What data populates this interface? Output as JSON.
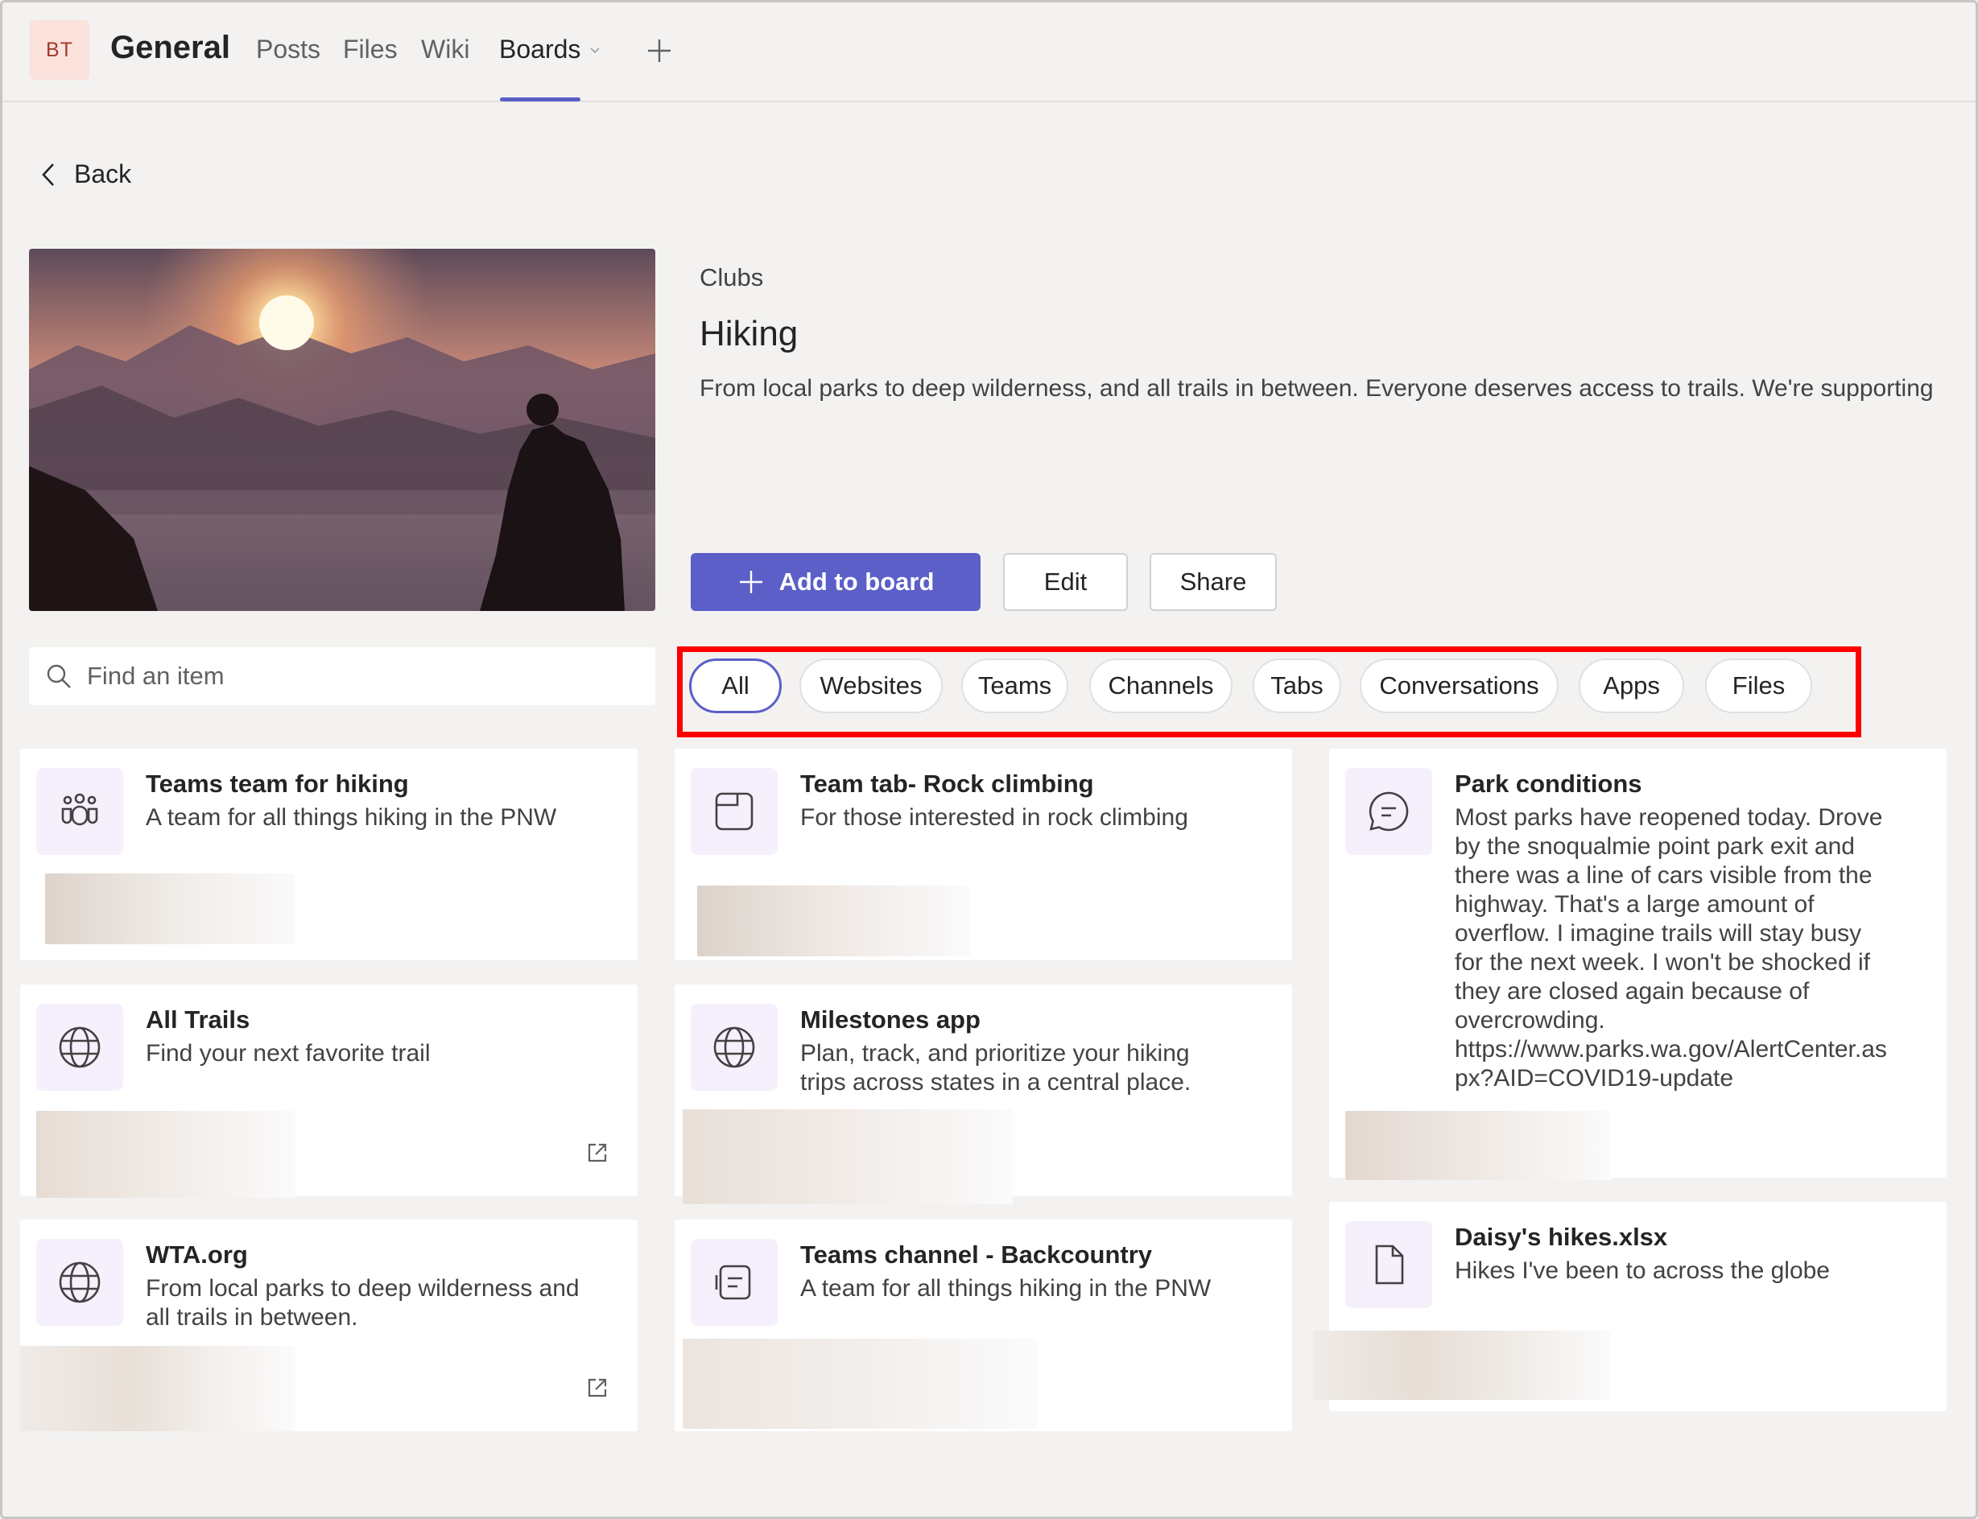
{
  "header": {
    "avatar_initials": "BT",
    "team_name": "General",
    "tabs": [
      {
        "label": "Posts"
      },
      {
        "label": "Files"
      },
      {
        "label": "Wiki"
      },
      {
        "label": "Boards",
        "active": true
      }
    ],
    "accent_color": "#5b5fc7"
  },
  "nav": {
    "back_label": "Back"
  },
  "board": {
    "category": "Clubs",
    "title": "Hiking",
    "description": "From local parks to deep wilderness, and all trails in between. Everyone deserves access to trails. We're supporting",
    "buttons": {
      "add": "Add to board",
      "edit": "Edit",
      "share": "Share"
    }
  },
  "search": {
    "placeholder": "Find an item"
  },
  "filters": [
    "All",
    "Websites",
    "Teams",
    "Channels",
    "Tabs",
    "Conversations",
    "Apps",
    "Files"
  ],
  "cards": [
    {
      "icon": "teams-icon",
      "title": "Teams team for hiking",
      "desc": "A team for all things hiking in the PNW"
    },
    {
      "icon": "tab-icon",
      "title": "Team tab- Rock climbing",
      "desc": "For those interested in rock climbing"
    },
    {
      "icon": "conversation-icon",
      "title": "Park conditions",
      "desc_lines": [
        "Most parks have reopened today. Drove",
        "by the snoqualmie point park exit and",
        "there was a line of cars visible from the",
        "highway. That's a large amount of",
        "overflow. I imagine trails will stay busy",
        "for the next week. I won't be shocked if",
        "they are closed again because of",
        "overcrowding.",
        "https://www.parks.wa.gov/AlertCenter.as",
        "px?AID=COVID19-update"
      ]
    },
    {
      "icon": "globe-icon",
      "title": "All Trails",
      "desc": "Find your next favorite trail"
    },
    {
      "icon": "globe-icon",
      "title": "Milestones app",
      "desc_lines": [
        "Plan, track, and prioritize your hiking",
        "trips across states in a central place."
      ]
    },
    {
      "icon": "globe-icon",
      "title": "WTA.org",
      "desc_lines": [
        "From local parks to deep wilderness and",
        "all trails in between."
      ]
    },
    {
      "icon": "channel-icon",
      "title": "Teams channel - Backcountry",
      "desc": "A team for all things hiking in the PNW"
    },
    {
      "icon": "file-icon",
      "title": "Daisy's hikes.xlsx",
      "desc": "Hikes I've been to across the globe"
    }
  ]
}
